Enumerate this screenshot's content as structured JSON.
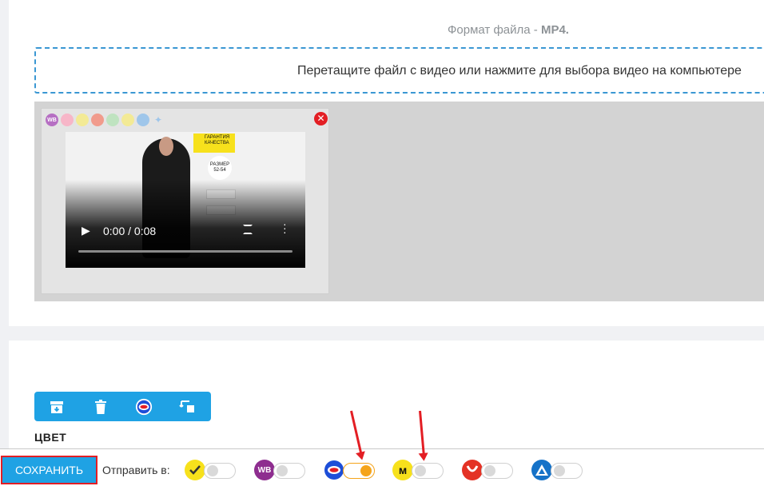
{
  "upload": {
    "format_prefix": "Формат файла -",
    "format_value": "MP4.",
    "dropzone_text": "Перетащите файл с видео или нажмите для выбора видео на компьютере"
  },
  "video": {
    "time": "0:00 / 0:08",
    "overlay_badge": "ГАРАНТИЯ КАЧЕСТВА",
    "overlay_size": "РАЗМЕР 52-54"
  },
  "section": {
    "color_label": "ЦВЕТ"
  },
  "footer": {
    "save_label": "СОХРАНИТЬ",
    "send_to_label": "Отправить в:",
    "marketplaces": [
      {
        "icon": "check-badge-icon",
        "color": "#f7e11c",
        "enabled": false
      },
      {
        "icon": "wb-icon",
        "color": "#8e2d8f",
        "text": "WB",
        "enabled": false
      },
      {
        "icon": "ozon-icon",
        "color": "#1d4ed8",
        "enabled": true
      },
      {
        "icon": "yandex-market-icon",
        "color": "#f7e11c",
        "enabled": false
      },
      {
        "icon": "aliexpress-icon",
        "color": "#e43225",
        "enabled": false
      },
      {
        "icon": "sber-icon",
        "color": "#1572c8",
        "enabled": false
      }
    ]
  },
  "colors": {
    "accent": "#1fa2e4",
    "highlight": "#e31e24",
    "toggle_on": "#f5a41a"
  }
}
